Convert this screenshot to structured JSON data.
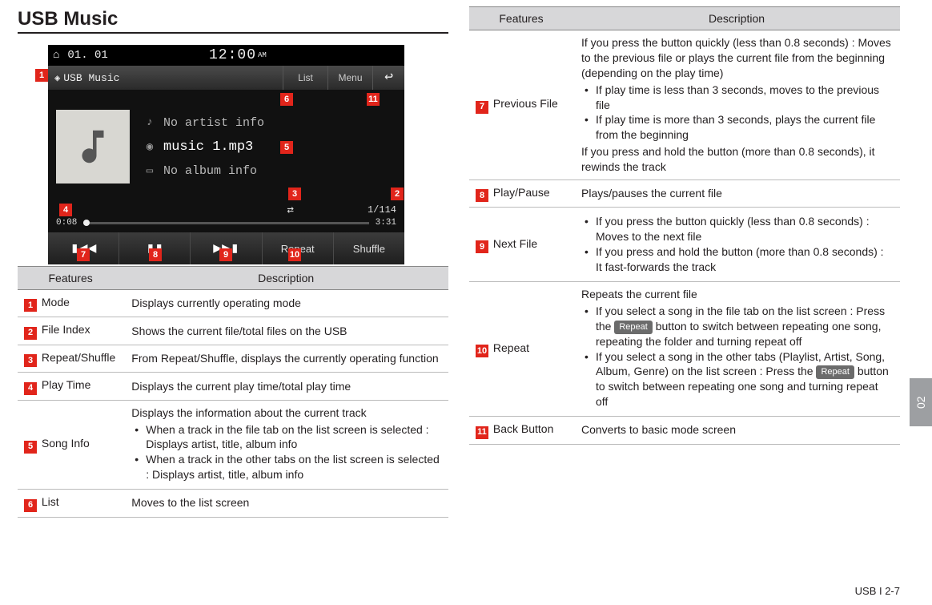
{
  "page": {
    "title": "USB Music",
    "footer": "USB I 2-7",
    "side_tab": "02"
  },
  "screenshot": {
    "status_date": "01. 01",
    "status_time": "12:00",
    "status_ampm": "AM",
    "app_title": "USB Music",
    "list_btn": "List",
    "menu_btn": "Menu",
    "artist": "No artist info",
    "song": "music 1.mp3",
    "album": "No album info",
    "file_index": "1/114",
    "time_cur": "0:08",
    "time_tot": "3:31",
    "repeat_btn": "Repeat",
    "shuffle_btn": "Shuffle"
  },
  "markers": [
    "1",
    "2",
    "3",
    "4",
    "5",
    "6",
    "7",
    "8",
    "9",
    "10",
    "11"
  ],
  "table_head": {
    "features": "Features",
    "description": "Description"
  },
  "button_label": "Repeat",
  "left_rows": [
    {
      "n": "1",
      "name": "Mode",
      "desc": "Displays currently operating mode"
    },
    {
      "n": "2",
      "name": "File Index",
      "desc": "Shows the current file/total files on the USB"
    },
    {
      "n": "3",
      "name": "Repeat/Shuffle",
      "desc": "From Repeat/Shuffle, displays the currently operating function"
    },
    {
      "n": "4",
      "name": "Play Time",
      "desc": "Displays the current play time/total play time"
    },
    {
      "n": "5",
      "name": "Song Info",
      "desc_lead": "Displays the information about the current track",
      "bullets": [
        "When a track in the file tab on the list screen is selected : Displays artist, title, album info",
        "When a track in the other tabs on the list screen is selected : Displays artist, title, album info"
      ]
    },
    {
      "n": "6",
      "name": "List",
      "desc": "Moves to the list screen"
    }
  ],
  "right_rows": [
    {
      "n": "7",
      "name": "Previous File",
      "desc_lead": "If you press the button quickly (less than 0.8 seconds) : Moves to the previous file or plays the current file from the beginning (depending on the play time)",
      "bullets": [
        "If play time is less than 3 seconds, moves to the previous file",
        "If play time is more than 3 seconds, plays the current file from the beginning"
      ],
      "desc_tail": "If you press and hold the button (more than 0.8 seconds), it rewinds the track"
    },
    {
      "n": "8",
      "name": "Play/Pause",
      "desc": "Plays/pauses the current file"
    },
    {
      "n": "9",
      "name": "Next File",
      "bullets": [
        "If you press the button quickly (less than 0.8 seconds) : Moves to the next file",
        "If you press and hold the button (more than 0.8 seconds) : It fast-forwards the track"
      ]
    },
    {
      "n": "10",
      "name": "Repeat",
      "desc_lead": "Repeats the current file",
      "rich_bullets": [
        {
          "pre": "If you select a song in the file tab on the list screen : Press the ",
          "pill": true,
          "post": " button to switch between repeating one song, repeating the folder and turning repeat off"
        },
        {
          "pre": "If you select a song in the other tabs (Playlist, Artist, Song, Album, Genre) on the list screen : Press the ",
          "pill": true,
          "post": " button to switch between repeating one song and turning repeat off"
        }
      ]
    },
    {
      "n": "11",
      "name": "Back Button",
      "desc": "Converts to basic mode screen"
    }
  ]
}
